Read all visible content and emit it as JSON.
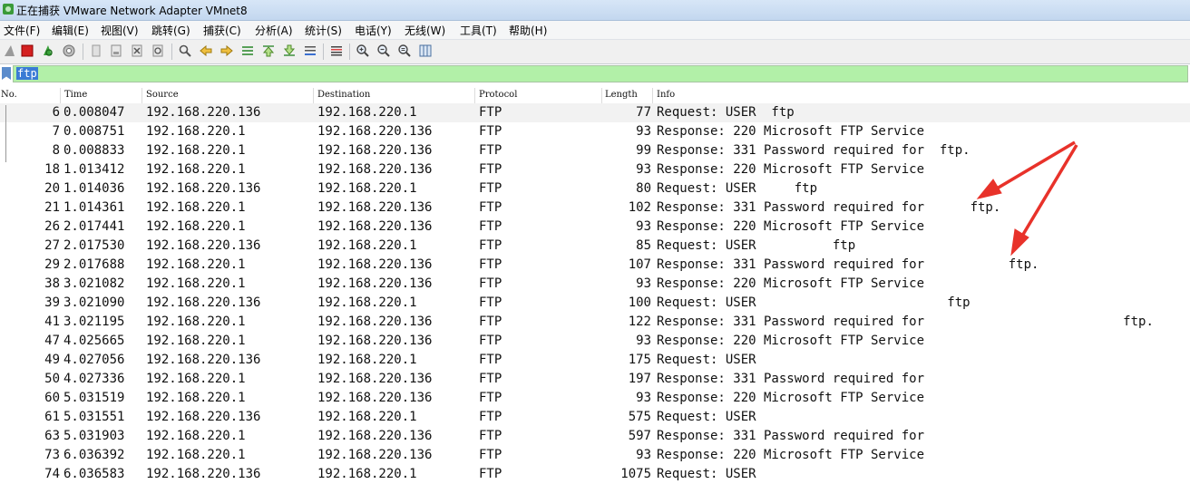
{
  "window": {
    "title": "正在捕获 VMware Network Adapter VMnet8"
  },
  "menu": [
    {
      "label": "文件(F)"
    },
    {
      "label": "编辑(E)"
    },
    {
      "label": "视图(V)"
    },
    {
      "label": "跳转(G)"
    },
    {
      "label": "捕获(C)"
    },
    {
      "label": "分析(A)"
    },
    {
      "label": "统计(S)"
    },
    {
      "label": "电话(Y)"
    },
    {
      "label": "无线(W)"
    },
    {
      "label": "工具(T)"
    },
    {
      "label": "帮助(H)"
    }
  ],
  "toolbar": {
    "icons": [
      "shark-fin-start-icon",
      "stop-capture-icon",
      "restart-capture-icon",
      "capture-options-icon",
      "open-file-icon",
      "save-file-icon",
      "close-file-icon",
      "reload-file-icon",
      "find-packet-icon",
      "go-back-icon",
      "go-forward-icon",
      "go-to-packet-icon",
      "first-packet-icon",
      "last-packet-icon",
      "auto-scroll-icon",
      "colorize-icon",
      "zoom-in-icon",
      "zoom-out-icon",
      "normal-size-icon",
      "resize-columns-icon"
    ]
  },
  "filter": {
    "value": "ftp",
    "bg_color": "#b2f0a8"
  },
  "columns": {
    "no": "No.",
    "time": "Time",
    "source": "Source",
    "destination": "Destination",
    "protocol": "Protocol",
    "length": "Length",
    "info": "Info"
  },
  "packets": [
    {
      "no": "6",
      "time": "0.008047",
      "src": "192.168.220.136",
      "dst": "192.168.220.1",
      "proto": "FTP",
      "len": "77",
      "info": "Request: USER  ftp"
    },
    {
      "no": "7",
      "time": "0.008751",
      "src": "192.168.220.1",
      "dst": "192.168.220.136",
      "proto": "FTP",
      "len": "93",
      "info": "Response: 220 Microsoft FTP Service"
    },
    {
      "no": "8",
      "time": "0.008833",
      "src": "192.168.220.1",
      "dst": "192.168.220.136",
      "proto": "FTP",
      "len": "99",
      "info": "Response: 331 Password required for  ftp."
    },
    {
      "no": "18",
      "time": "1.013412",
      "src": "192.168.220.1",
      "dst": "192.168.220.136",
      "proto": "FTP",
      "len": "93",
      "info": "Response: 220 Microsoft FTP Service"
    },
    {
      "no": "20",
      "time": "1.014036",
      "src": "192.168.220.136",
      "dst": "192.168.220.1",
      "proto": "FTP",
      "len": "80",
      "info": "Request: USER     ftp"
    },
    {
      "no": "21",
      "time": "1.014361",
      "src": "192.168.220.1",
      "dst": "192.168.220.136",
      "proto": "FTP",
      "len": "102",
      "info": "Response: 331 Password required for      ftp."
    },
    {
      "no": "26",
      "time": "2.017441",
      "src": "192.168.220.1",
      "dst": "192.168.220.136",
      "proto": "FTP",
      "len": "93",
      "info": "Response: 220 Microsoft FTP Service"
    },
    {
      "no": "27",
      "time": "2.017530",
      "src": "192.168.220.136",
      "dst": "192.168.220.1",
      "proto": "FTP",
      "len": "85",
      "info": "Request: USER          ftp"
    },
    {
      "no": "29",
      "time": "2.017688",
      "src": "192.168.220.1",
      "dst": "192.168.220.136",
      "proto": "FTP",
      "len": "107",
      "info": "Response: 331 Password required for           ftp."
    },
    {
      "no": "38",
      "time": "3.021082",
      "src": "192.168.220.1",
      "dst": "192.168.220.136",
      "proto": "FTP",
      "len": "93",
      "info": "Response: 220 Microsoft FTP Service"
    },
    {
      "no": "39",
      "time": "3.021090",
      "src": "192.168.220.136",
      "dst": "192.168.220.1",
      "proto": "FTP",
      "len": "100",
      "info": "Request: USER                         ftp"
    },
    {
      "no": "41",
      "time": "3.021195",
      "src": "192.168.220.1",
      "dst": "192.168.220.136",
      "proto": "FTP",
      "len": "122",
      "info": "Response: 331 Password required for                          ftp."
    },
    {
      "no": "47",
      "time": "4.025665",
      "src": "192.168.220.1",
      "dst": "192.168.220.136",
      "proto": "FTP",
      "len": "93",
      "info": "Response: 220 Microsoft FTP Service"
    },
    {
      "no": "49",
      "time": "4.027056",
      "src": "192.168.220.136",
      "dst": "192.168.220.1",
      "proto": "FTP",
      "len": "175",
      "info": "Request: USER"
    },
    {
      "no": "50",
      "time": "4.027336",
      "src": "192.168.220.1",
      "dst": "192.168.220.136",
      "proto": "FTP",
      "len": "197",
      "info": "Response: 331 Password required for"
    },
    {
      "no": "60",
      "time": "5.031519",
      "src": "192.168.220.1",
      "dst": "192.168.220.136",
      "proto": "FTP",
      "len": "93",
      "info": "Response: 220 Microsoft FTP Service"
    },
    {
      "no": "61",
      "time": "5.031551",
      "src": "192.168.220.136",
      "dst": "192.168.220.1",
      "proto": "FTP",
      "len": "575",
      "info": "Request: USER"
    },
    {
      "no": "63",
      "time": "5.031903",
      "src": "192.168.220.1",
      "dst": "192.168.220.136",
      "proto": "FTP",
      "len": "597",
      "info": "Response: 331 Password required for"
    },
    {
      "no": "73",
      "time": "6.036392",
      "src": "192.168.220.1",
      "dst": "192.168.220.136",
      "proto": "FTP",
      "len": "93",
      "info": "Response: 220 Microsoft FTP Service"
    },
    {
      "no": "74",
      "time": "6.036583",
      "src": "192.168.220.136",
      "dst": "192.168.220.1",
      "proto": "FTP",
      "len": "1075",
      "info": "Request: USER"
    }
  ],
  "annotations": {
    "arrow_color": "#e8322a"
  }
}
